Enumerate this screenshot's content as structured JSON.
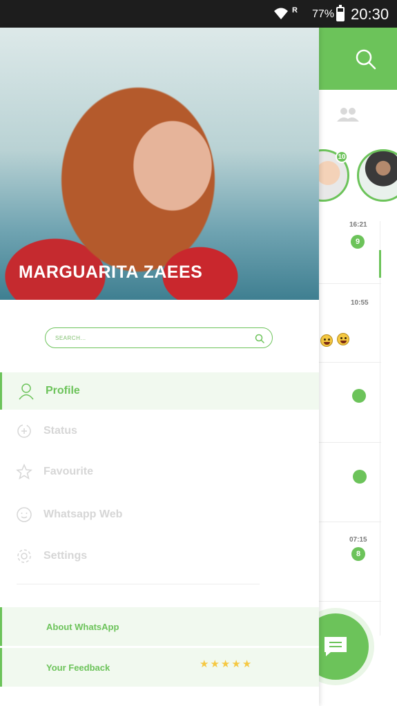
{
  "status_bar": {
    "signal_label": "R",
    "battery_percent": "77%",
    "time": "20:30"
  },
  "background": {
    "story_badge": "10",
    "chats": [
      {
        "time": "16:21",
        "unread": "9"
      },
      {
        "time": "10:55",
        "unread": ""
      },
      {
        "time": "",
        "unread": ""
      },
      {
        "time": "",
        "unread": ""
      },
      {
        "time": "07:15",
        "unread": "8"
      }
    ]
  },
  "drawer": {
    "profile_name": "MARGUARITA ZAEES",
    "search_placeholder": "SEARCH...",
    "menu": [
      {
        "label": "Profile",
        "icon": "user-icon",
        "active": true
      },
      {
        "label": "Status",
        "icon": "status-icon",
        "active": false
      },
      {
        "label": "Favourite",
        "icon": "star-icon",
        "active": false
      },
      {
        "label": "Whatsapp Web",
        "icon": "web-icon",
        "active": false
      },
      {
        "label": "Settings",
        "icon": "gear-icon",
        "active": false
      }
    ],
    "footer": {
      "about_label": "About WhatsApp",
      "feedback_label": "Your Feedback",
      "rating": 5
    }
  },
  "colors": {
    "accent": "#6cc35a",
    "inactive_text": "#d6d6d6",
    "active_bg": "#f1f9ef"
  }
}
